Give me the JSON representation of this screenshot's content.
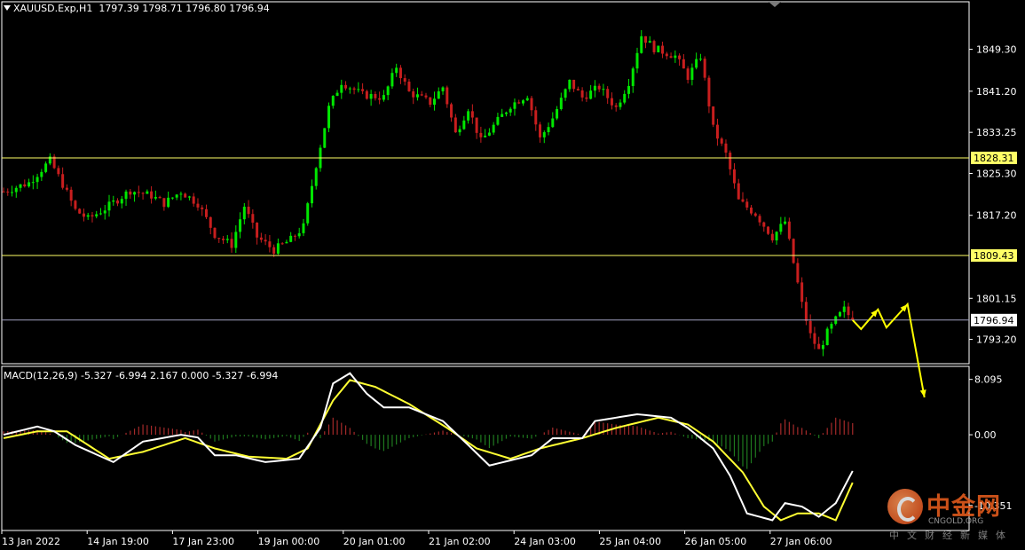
{
  "header": {
    "symbol_line": "XAUUSD.Exp,H1  1797.39 1798.71 1796.80 1796.94"
  },
  "macd_header": "MACD(12,26,9) -5.327 -6.994 2.167 0.000 -5.327 -6.994",
  "watermark": {
    "cn": "中金网",
    "en": "CNGOLD.ORG",
    "sub": "中文财经新媒体"
  },
  "colors": {
    "background": "#000000",
    "bull_candle": "#00e600",
    "bear_candle": "#c81e1e",
    "level_line": "#ffff66",
    "macd_line": "#ffffff",
    "signal_line": "#ffff33",
    "hist_positive": "#a52a2a",
    "hist_negative": "#1f7a1f",
    "arrow": "#ffff00",
    "current_price_line": "#a0a0c0"
  },
  "chart_data": [
    {
      "type": "candlestick",
      "symbol": "XAUUSD.Exp",
      "timeframe": "H1",
      "ohlc_last": {
        "open": 1797.39,
        "high": 1798.71,
        "low": 1796.8,
        "close": 1796.94
      },
      "ylim": [
        1788.5,
        1858.5
      ],
      "y_ticks": [
        "1849.30",
        "1841.20",
        "1833.25",
        "1825.30",
        "1817.20",
        "1801.15",
        "1793.20"
      ],
      "x_ticks": [
        "13 Jan 2022",
        "14 Jan 19:00",
        "17 Jan 23:00",
        "19 Jan 00:00",
        "20 Jan 01:00",
        "21 Jan 02:00",
        "24 Jan 03:00",
        "25 Jan 04:00",
        "26 Jan 05:00",
        "27 Jan 06:00"
      ],
      "levels": [
        {
          "label": "1828.31",
          "value": 1828.31,
          "kind": "horizontal-line"
        },
        {
          "label": "1809.43",
          "value": 1809.43,
          "kind": "horizontal-line"
        }
      ],
      "current_price": {
        "label": "1796.94",
        "value": 1796.94
      },
      "close_path": [
        [
          0,
          1821.8
        ],
        [
          6,
          1823.5
        ],
        [
          11,
          1827.8
        ],
        [
          14,
          1823.2
        ],
        [
          17,
          1818.2
        ],
        [
          20,
          1816.5
        ],
        [
          24,
          1818.5
        ],
        [
          30,
          1822.0
        ],
        [
          35,
          1821.0
        ],
        [
          38,
          1819.5
        ],
        [
          42,
          1821.8
        ],
        [
          46,
          1819.5
        ],
        [
          50,
          1813.5
        ],
        [
          54,
          1811.5
        ],
        [
          57,
          1819.0
        ],
        [
          60,
          1813.0
        ],
        [
          64,
          1810.5
        ],
        [
          68,
          1812.5
        ],
        [
          71,
          1815.0
        ],
        [
          74,
          1827.0
        ],
        [
          77,
          1838.0
        ],
        [
          80,
          1843.0
        ],
        [
          85,
          1840.5
        ],
        [
          90,
          1840.0
        ],
        [
          93,
          1846.0
        ],
        [
          96,
          1841.0
        ],
        [
          101,
          1839.0
        ],
        [
          104,
          1842.0
        ],
        [
          107,
          1833.0
        ],
        [
          110,
          1838.0
        ],
        [
          113,
          1831.5
        ],
        [
          117,
          1835.5
        ],
        [
          120,
          1838.5
        ],
        [
          124,
          1840.5
        ],
        [
          127,
          1832.0
        ],
        [
          130,
          1836.0
        ],
        [
          134,
          1843.0
        ],
        [
          137,
          1840.0
        ],
        [
          141,
          1842.0
        ],
        [
          145,
          1838.0
        ],
        [
          148,
          1843.0
        ],
        [
          151,
          1852.0
        ],
        [
          154,
          1849.5
        ],
        [
          159,
          1848.0
        ],
        [
          162,
          1844.0
        ],
        [
          165,
          1848.0
        ],
        [
          168,
          1834.0
        ],
        [
          171,
          1829.0
        ],
        [
          174,
          1820.0
        ],
        [
          178,
          1817.5
        ],
        [
          182,
          1813.0
        ],
        [
          185,
          1816.0
        ],
        [
          187,
          1808.0
        ],
        [
          189,
          1800.0
        ],
        [
          191,
          1794.0
        ],
        [
          193,
          1791.0
        ],
        [
          195,
          1794.5
        ],
        [
          197,
          1797.0
        ],
        [
          199,
          1799.0
        ],
        [
          201,
          1796.9
        ]
      ],
      "forecast_arrows": [
        [
          201,
          1796.94
        ],
        [
          203,
          1795.2
        ],
        [
          207,
          1799.0
        ],
        [
          209,
          1795.5
        ],
        [
          214,
          1800.0
        ],
        [
          218,
          1782.0
        ]
      ]
    },
    {
      "type": "macd",
      "params": "12,26,9",
      "values": {
        "macd": -5.327,
        "signal": -6.994,
        "histogram": 2.167,
        "zero": 0.0
      },
      "ylim": [
        -14.0,
        10.0
      ],
      "y_ticks": [
        "8.095",
        "0.00",
        "-10.351"
      ],
      "macd_path": [
        [
          0,
          0.0
        ],
        [
          8,
          1.2
        ],
        [
          12,
          0.5
        ],
        [
          17,
          -1.5
        ],
        [
          26,
          -4.0
        ],
        [
          33,
          -1.0
        ],
        [
          42,
          0.0
        ],
        [
          46,
          -0.4
        ],
        [
          50,
          -3.0
        ],
        [
          55,
          -3.0
        ],
        [
          62,
          -4.0
        ],
        [
          70,
          -3.5
        ],
        [
          75,
          1.0
        ],
        [
          78,
          7.5
        ],
        [
          82,
          9.0
        ],
        [
          86,
          6.0
        ],
        [
          90,
          4.0
        ],
        [
          96,
          4.0
        ],
        [
          104,
          2.0
        ],
        [
          110,
          -1.5
        ],
        [
          115,
          -4.5
        ],
        [
          125,
          -3.0
        ],
        [
          130,
          -0.5
        ],
        [
          137,
          -0.5
        ],
        [
          140,
          2.0
        ],
        [
          150,
          3.0
        ],
        [
          158,
          2.5
        ],
        [
          162,
          1.0
        ],
        [
          168,
          -2.0
        ],
        [
          172,
          -6.0
        ],
        [
          176,
          -11.5
        ],
        [
          182,
          -12.5
        ],
        [
          185,
          -10.0
        ],
        [
          189,
          -10.5
        ],
        [
          193,
          -12.0
        ],
        [
          197,
          -10.0
        ],
        [
          201,
          -5.3
        ]
      ],
      "signal_path": [
        [
          0,
          -0.5
        ],
        [
          8,
          0.5
        ],
        [
          15,
          0.5
        ],
        [
          25,
          -3.5
        ],
        [
          33,
          -2.5
        ],
        [
          43,
          -0.5
        ],
        [
          50,
          -2.0
        ],
        [
          58,
          -3.2
        ],
        [
          67,
          -3.5
        ],
        [
          72,
          -2.0
        ],
        [
          78,
          5.0
        ],
        [
          82,
          8.0
        ],
        [
          88,
          7.0
        ],
        [
          96,
          4.5
        ],
        [
          105,
          1.0
        ],
        [
          112,
          -2.0
        ],
        [
          120,
          -3.5
        ],
        [
          127,
          -2.0
        ],
        [
          137,
          -0.5
        ],
        [
          145,
          1.0
        ],
        [
          155,
          2.5
        ],
        [
          162,
          1.5
        ],
        [
          168,
          -1.0
        ],
        [
          175,
          -5.5
        ],
        [
          180,
          -10.5
        ],
        [
          184,
          -12.5
        ],
        [
          188,
          -11.5
        ],
        [
          193,
          -11.5
        ],
        [
          197,
          -12.5
        ],
        [
          201,
          -7.0
        ]
      ]
    }
  ]
}
